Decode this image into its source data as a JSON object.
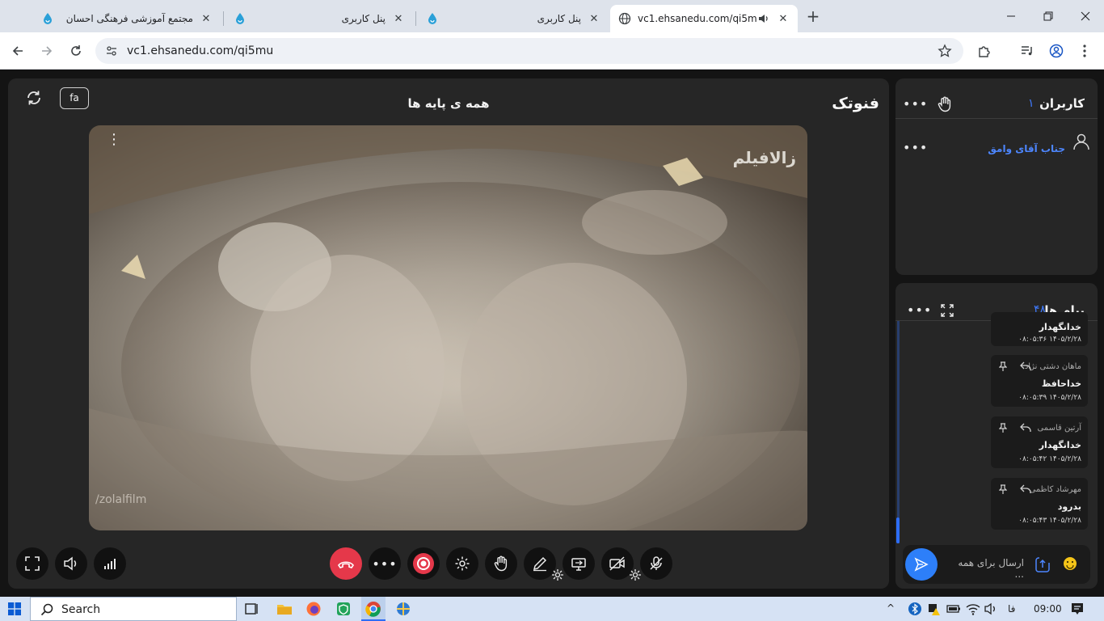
{
  "browser": {
    "tabs": [
      {
        "title": "مجتمع آموزشی فرهنگی احسان",
        "active": false
      },
      {
        "title": "پنل کاربری",
        "active": false
      },
      {
        "title": "پنل کاربری",
        "active": false
      },
      {
        "title": "vc1.ehsanedu.com/qi5mu",
        "active": true
      }
    ],
    "new_tab_label": "+",
    "url": "vc1.ehsanedu.com/qi5mu"
  },
  "stage": {
    "brand": "فنوتک",
    "title": "همه ی پایه ها",
    "lang_button": "fa",
    "watermark_top": "زالافیلم",
    "watermark_bottom": "/zolalfilm"
  },
  "users": {
    "title": "کاربران",
    "count": "۱",
    "list": [
      {
        "name": "جناب آقای وامق"
      }
    ]
  },
  "chat": {
    "title": "پیام ها",
    "count": "۴۸",
    "messages": [
      {
        "sender": "",
        "text": "خدانگهدار",
        "time": "۰۸:۰۵:۳۶ ۱۴۰۵/۲/۲۸"
      },
      {
        "sender": "ماهان دشتی نژاد",
        "text": "خداحافظ",
        "time": "۰۸:۰۵:۳۹ ۱۴۰۵/۲/۲۸"
      },
      {
        "sender": "آرتین قاسمی",
        "text": "خدانگهدار",
        "time": "۰۸:۰۵:۴۲ ۱۴۰۵/۲/۲۸"
      },
      {
        "sender": "مهرشاد کاظمی",
        "text": "بدرود",
        "time": "۰۸:۰۵:۴۳ ۱۴۰۵/۲/۲۸"
      }
    ],
    "input_placeholder": "ارسال برای همه ..."
  },
  "taskbar": {
    "search_label": "Search",
    "lang": "فا",
    "time": "09:00"
  },
  "colors": {
    "accent": "#2d7ff9",
    "record_red": "#e5384a",
    "panel_bg": "#262626"
  }
}
